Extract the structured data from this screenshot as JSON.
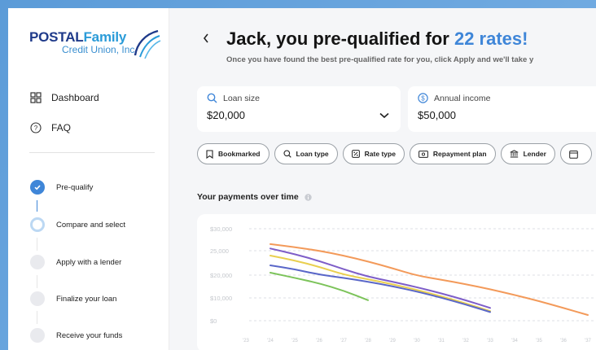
{
  "logo": {
    "line1a": "POSTAL",
    "line1b": "Family",
    "line2": "Credit Union, Inc."
  },
  "nav": [
    {
      "label": "Dashboard",
      "icon": "dashboard-icon"
    },
    {
      "label": "FAQ",
      "icon": "help-circle-icon"
    }
  ],
  "steps": [
    {
      "label": "Pre-qualify",
      "status": "done"
    },
    {
      "label": "Compare and select",
      "status": "current"
    },
    {
      "label": "Apply with a lender",
      "status": "pending"
    },
    {
      "label": "Finalize your loan",
      "status": "pending"
    },
    {
      "label": "Receive your funds",
      "status": "pending"
    }
  ],
  "header": {
    "back_icon": "chevron-left-icon",
    "title_prefix": "Jack, you pre-qualified for ",
    "title_highlight": "22 rates!",
    "subtitle": "Once you have found the best pre-qualified rate for you, click Apply and we'll take y"
  },
  "loan_size": {
    "label": "Loan size",
    "value": "$20,000"
  },
  "annual_income": {
    "label": "Annual income",
    "value": "$50,000"
  },
  "filters": [
    {
      "label": "Bookmarked",
      "icon": "bookmark-icon"
    },
    {
      "label": "Loan type",
      "icon": "search-icon"
    },
    {
      "label": "Rate type",
      "icon": "percent-icon"
    },
    {
      "label": "Repayment plan",
      "icon": "money-icon"
    },
    {
      "label": "Lender",
      "icon": "bank-icon"
    },
    {
      "label": "",
      "icon": "calendar-icon"
    }
  ],
  "chart_section": {
    "title": "Your payments over time",
    "info_icon": "info-icon"
  },
  "colors": {
    "accent": "#3f86d8",
    "orange": "#f39a5a",
    "purple": "#7e5ec8",
    "yellow": "#e9cf4f",
    "indigo": "#5a67c8",
    "green": "#7cc35a"
  },
  "chart_data": {
    "type": "line",
    "ylabels": [
      "$30,000",
      "25,000",
      "$20,000",
      "$10,000",
      "$0"
    ],
    "xlabels": [
      "'23",
      "'24",
      "'25",
      "'26",
      "'27",
      "'28",
      "'29",
      "'30",
      "'31",
      "'32",
      "'33",
      "'34",
      "'35",
      "'36",
      "'37"
    ],
    "x": [
      2024,
      2025,
      2026,
      2027,
      2028,
      2029,
      2030,
      2031,
      2032,
      2033,
      2034,
      2035,
      2036,
      2037
    ],
    "series": [
      {
        "color": "#f39a5a",
        "values": [
          26500,
          25800,
          25000,
          24000,
          22800,
          21400,
          19800,
          18000,
          16000,
          13800,
          11300,
          8600,
          5600,
          2500
        ]
      },
      {
        "color": "#7e5ec8",
        "values": [
          25500,
          24300,
          22900,
          21200,
          19300,
          17100,
          14700,
          12000,
          9000,
          5600
        ]
      },
      {
        "color": "#e9cf4f",
        "values": [
          24000,
          23000,
          21700,
          20100,
          18200,
          16000,
          13500,
          10700,
          7600,
          4200
        ]
      },
      {
        "color": "#5a67c8",
        "values": [
          22000,
          21200,
          20100,
          18800,
          17100,
          15100,
          12800,
          10100,
          7100,
          3800
        ]
      },
      {
        "color": "#7cc35a",
        "values": [
          20500,
          18800,
          16400,
          13200,
          9000
        ]
      }
    ],
    "ylim": [
      0,
      30000
    ]
  }
}
